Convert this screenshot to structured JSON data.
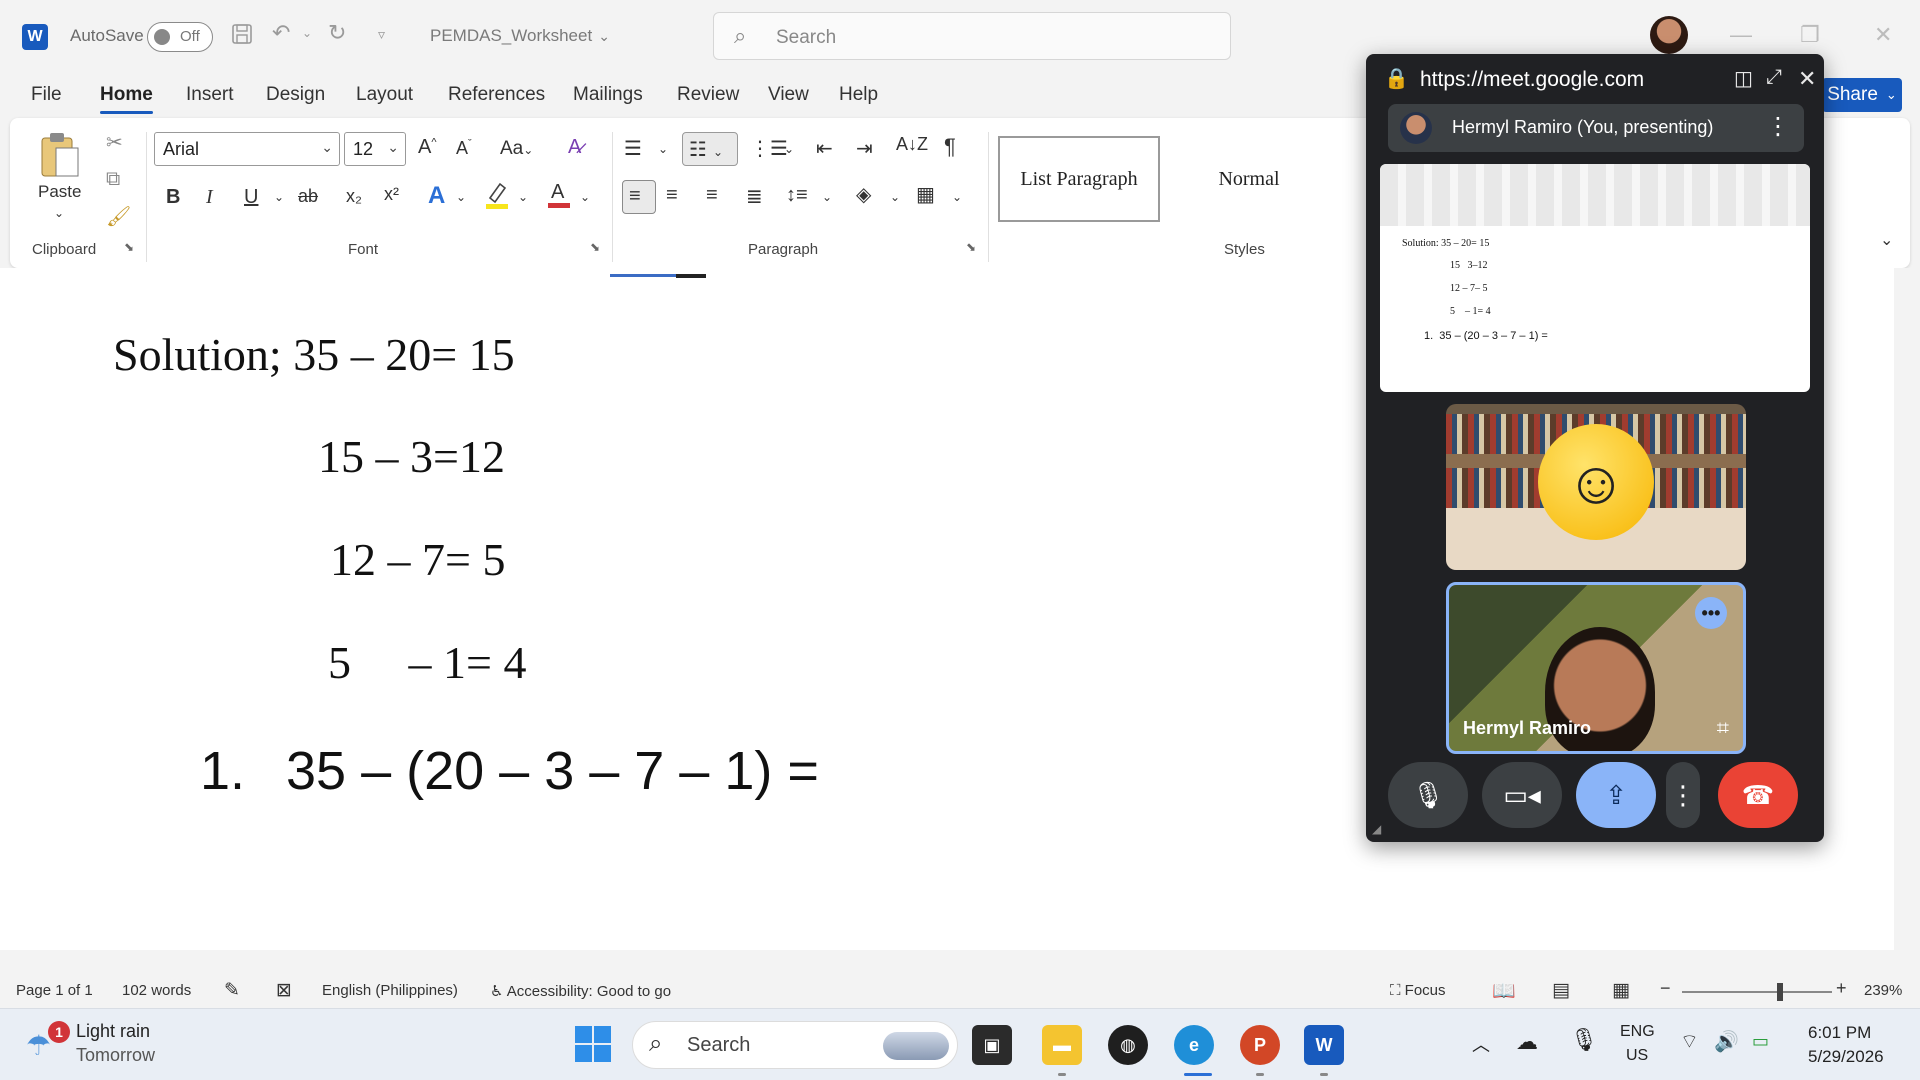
{
  "titlebar": {
    "logo": "W",
    "autosave_label": "AutoSave",
    "autosave_state": "Off",
    "doc_title": "PEMDAS_Worksheet",
    "search_placeholder": "Search",
    "icons": [
      "save-icon",
      "undo-icon",
      "redo-icon",
      "customize-icon",
      "search-icon",
      "minimize-icon",
      "restore-icon",
      "close-icon"
    ]
  },
  "menu": {
    "items": [
      "File",
      "Home",
      "Insert",
      "Design",
      "Layout",
      "References",
      "Mailings",
      "Review",
      "View",
      "Help"
    ],
    "share_label": "Share",
    "accent": "#185abd"
  },
  "ribbon": {
    "paste_label": "Paste",
    "clipboard_label": "Clipboard",
    "font_name": "Arial",
    "font_size": "12",
    "font_label": "Font",
    "paragraph_label": "Paragraph",
    "styles_label": "Styles",
    "case_label": "Aa",
    "style_list_paragraph": "List Paragraph",
    "style_normal": "Normal",
    "bold": "B",
    "italic": "I",
    "underline": "U",
    "strike": "ab",
    "subscript": "x₂",
    "superscript": "x²",
    "sort": "A↓Z",
    "pilcrow": "¶"
  },
  "document": {
    "lines": [
      "Solution; 35 – 20= 15",
      "15 – 3=12",
      "12 – 7= 5",
      "5     – 1= 4"
    ],
    "list_number": "1.",
    "list_text": "35 – (20 – 3 – 7 – 1) ="
  },
  "statusbar": {
    "page": "Page 1 of 1",
    "words": "102 words",
    "language": "English (Philippines)",
    "accessibility": "Accessibility: Good to go",
    "focus": "Focus",
    "zoom": "239%"
  },
  "taskbar": {
    "weather_title": "Light rain",
    "weather_sub": "Tomorrow",
    "weather_badge": "1",
    "search_label": "Search",
    "lang_top": "ENG",
    "lang_bottom": "US",
    "time": "6:01 PM",
    "date": "5/29/2026"
  },
  "meet": {
    "url": "https://meet.google.com",
    "presenter": "Hermyl Ramiro (You, presenting)",
    "preview_lines": [
      "Solution: 35 – 20= 15",
      "15   3–12",
      "12 – 7– 5",
      "5    – 1= 4",
      "1.  35 – (20 – 3 – 7 – 1) ="
    ],
    "participant_name": "Hermyl Ramiro",
    "colors": {
      "panel": "#202124",
      "present_btn": "#8ab4f8",
      "end_call": "#ea4335"
    }
  }
}
